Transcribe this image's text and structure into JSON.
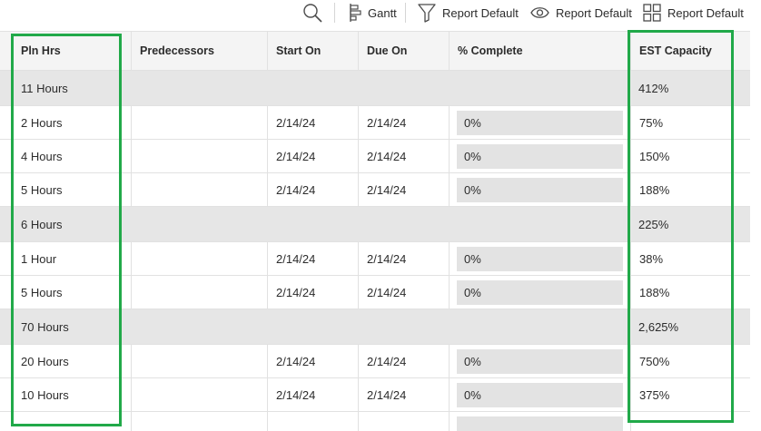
{
  "toolbar": {
    "search_icon": "search-icon",
    "gantt_label": "Gantt",
    "filter_label": "Report Default",
    "view_label": "Report Default",
    "grouping_label": "Report Default"
  },
  "columns": {
    "pln_hrs": "Pln Hrs",
    "predecessors": "Predecessors",
    "start_on": "Start On",
    "due_on": "Due On",
    "pct_complete": "% Complete",
    "est_capacity": "EST Capacity"
  },
  "rows": [
    {
      "type": "group",
      "pln_hrs": "11 Hours",
      "est_capacity": "412%"
    },
    {
      "type": "task",
      "pln_hrs": "2 Hours",
      "start_on": "2/14/24",
      "due_on": "2/14/24",
      "pct_complete": "0%",
      "est_capacity": "75%"
    },
    {
      "type": "task",
      "pln_hrs": "4 Hours",
      "start_on": "2/14/24",
      "due_on": "2/14/24",
      "pct_complete": "0%",
      "est_capacity": "150%"
    },
    {
      "type": "task",
      "pln_hrs": "5 Hours",
      "start_on": "2/14/24",
      "due_on": "2/14/24",
      "pct_complete": "0%",
      "est_capacity": "188%"
    },
    {
      "type": "group",
      "pln_hrs": "6 Hours",
      "est_capacity": "225%"
    },
    {
      "type": "task",
      "pln_hrs": "1 Hour",
      "start_on": "2/14/24",
      "due_on": "2/14/24",
      "pct_complete": "0%",
      "est_capacity": "38%"
    },
    {
      "type": "task",
      "pln_hrs": "5 Hours",
      "start_on": "2/14/24",
      "due_on": "2/14/24",
      "pct_complete": "0%",
      "est_capacity": "188%"
    },
    {
      "type": "group",
      "pln_hrs": "70 Hours",
      "est_capacity": "2,625%"
    },
    {
      "type": "task",
      "pln_hrs": "20 Hours",
      "start_on": "2/14/24",
      "due_on": "2/14/24",
      "pct_complete": "0%",
      "est_capacity": "750%"
    },
    {
      "type": "task",
      "pln_hrs": "10 Hours",
      "start_on": "2/14/24",
      "due_on": "2/14/24",
      "pct_complete": "0%",
      "est_capacity": "375%"
    },
    {
      "type": "task",
      "pln_hrs": "",
      "start_on": "",
      "due_on": "",
      "pct_complete": "",
      "est_capacity": ""
    }
  ],
  "colors": {
    "highlight": "#21a949",
    "group_row": "#e6e6e6",
    "header_row": "#f4f4f4",
    "progress_bg": "#e3e3e3"
  }
}
